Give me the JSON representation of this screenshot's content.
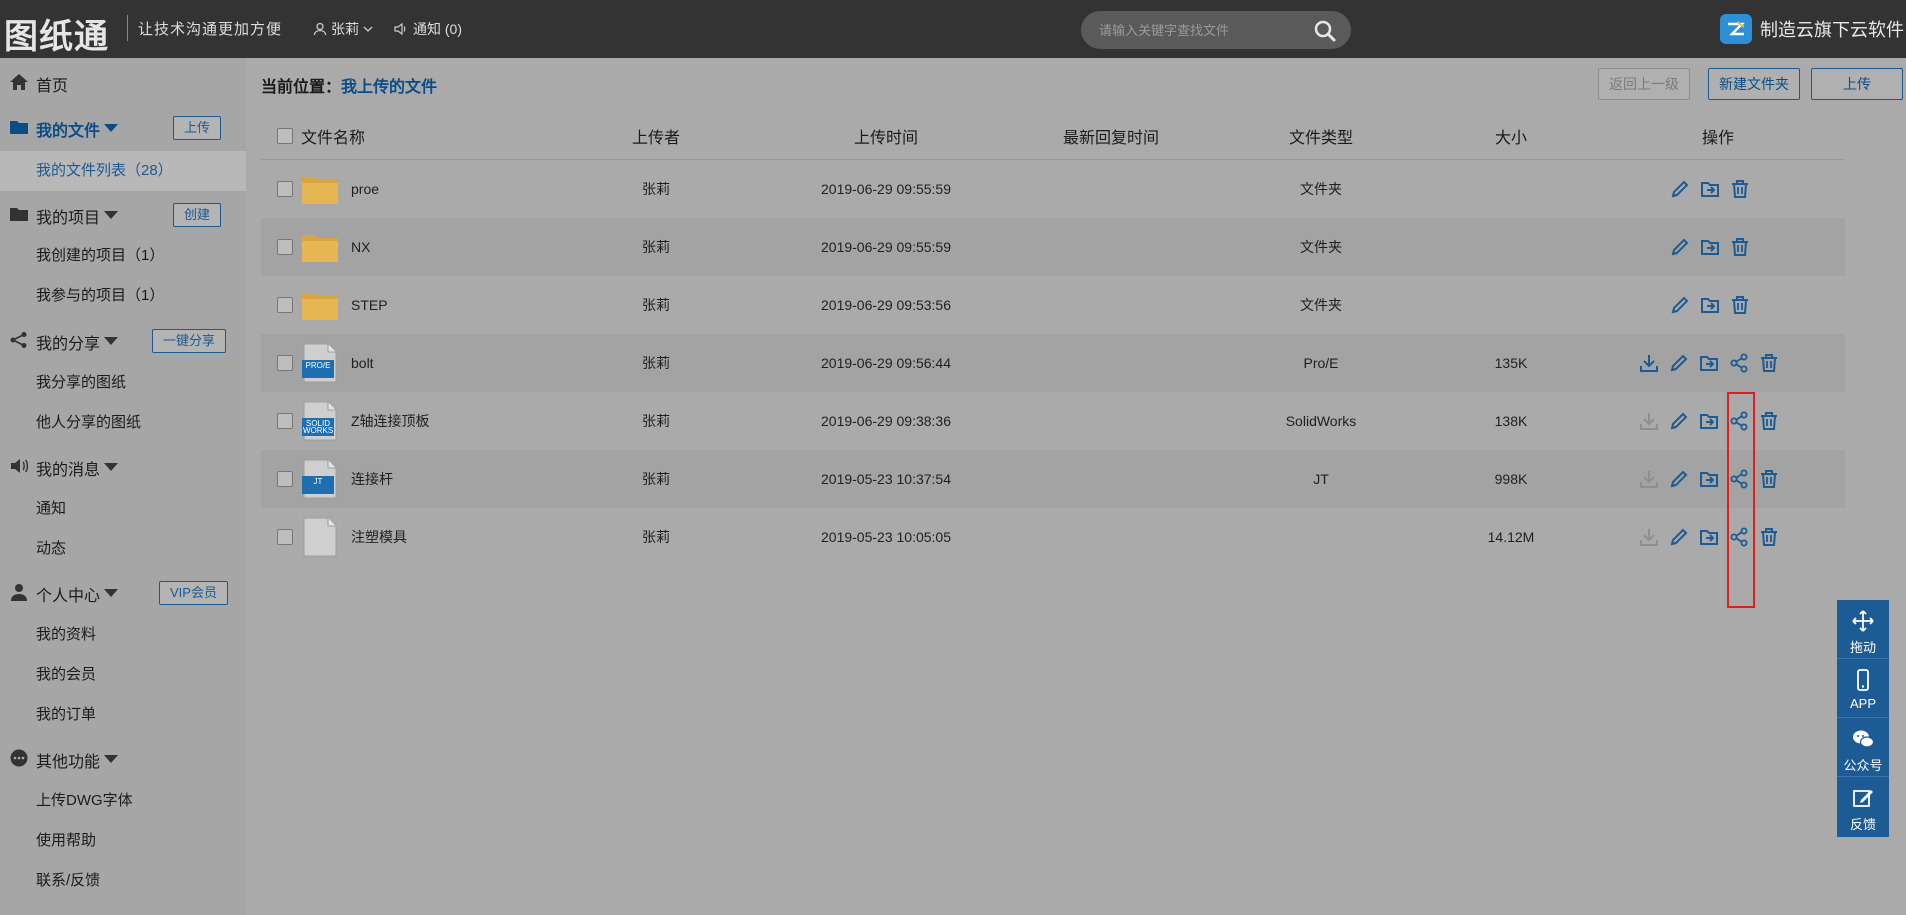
{
  "header": {
    "logo": "图纸通",
    "slogan": "让技术沟通更加方便",
    "user_name": "张莉",
    "notice": "通知 (0)",
    "search_placeholder": "请输入关键字查找文件",
    "brand": "制造云旗下云软件"
  },
  "sidebar": {
    "home": "首页",
    "my_files": "我的文件",
    "upload_btn": "上传",
    "my_file_list": "我的文件列表（28）",
    "my_projects": "我的项目",
    "create_btn": "创建",
    "created_projects": "我创建的项目（1）",
    "joined_projects": "我参与的项目（1）",
    "my_share": "我的分享",
    "share_btn": "一键分享",
    "my_shared_drawings": "我分享的图纸",
    "others_shared": "他人分享的图纸",
    "my_messages": "我的消息",
    "notice": "通知",
    "activity": "动态",
    "personal_center": "个人中心",
    "vip_btn": "VIP会员",
    "my_profile": "我的资料",
    "my_membership": "我的会员",
    "my_orders": "我的订单",
    "other_features": "其他功能",
    "upload_dwg_font": "上传DWG字体",
    "help": "使用帮助",
    "contact_feedback": "联系/反馈"
  },
  "main": {
    "breadcrumb_label": "当前位置：",
    "breadcrumb_current": "我上传的文件",
    "back_btn": "返回上一级",
    "new_folder_btn": "新建文件夹",
    "upload_btn": "上传"
  },
  "table": {
    "headers": {
      "name": "文件名称",
      "uploader": "上传者",
      "upload_time": "上传时间",
      "reply_time": "最新回复时间",
      "type": "文件类型",
      "size": "大小",
      "ops": "操作"
    },
    "rows": [
      {
        "name": "proe",
        "uploader": "张莉",
        "time": "2019-06-29 09:55:59",
        "reply": "",
        "type": "文件夹",
        "size": "",
        "thumb": "folder",
        "thumb_label": ""
      },
      {
        "name": "NX",
        "uploader": "张莉",
        "time": "2019-06-29 09:55:59",
        "reply": "",
        "type": "文件夹",
        "size": "",
        "thumb": "folder",
        "thumb_label": ""
      },
      {
        "name": "STEP",
        "uploader": "张莉",
        "time": "2019-06-29 09:53:56",
        "reply": "",
        "type": "文件夹",
        "size": "",
        "thumb": "folder",
        "thumb_label": ""
      },
      {
        "name": "bolt",
        "uploader": "张莉",
        "time": "2019-06-29 09:56:44",
        "reply": "",
        "type": "Pro/E",
        "size": "135K",
        "thumb": "file",
        "thumb_label": "PRO/E"
      },
      {
        "name": "Z轴连接顶板",
        "uploader": "张莉",
        "time": "2019-06-29 09:38:36",
        "reply": "",
        "type": "SolidWorks",
        "size": "138K",
        "thumb": "file",
        "thumb_label": "SOLID WORKS"
      },
      {
        "name": "连接杆",
        "uploader": "张莉",
        "time": "2019-05-23 10:37:54",
        "reply": "",
        "type": "JT",
        "size": "998K",
        "thumb": "file",
        "thumb_label": "JT"
      },
      {
        "name": "注塑模具",
        "uploader": "张莉",
        "time": "2019-05-23 10:05:05",
        "reply": "",
        "type": "",
        "size": "14.12M",
        "thumb": "file-blank",
        "thumb_label": ""
      }
    ]
  },
  "float_panel": {
    "drag": "拖动",
    "app": "APP",
    "wechat": "公众号",
    "feedback": "反馈"
  },
  "colors": {
    "header_bg": "#333333",
    "accent_blue": "#1d5b94",
    "highlight_red": "#e02020",
    "folder_gold": "#d9a441"
  }
}
